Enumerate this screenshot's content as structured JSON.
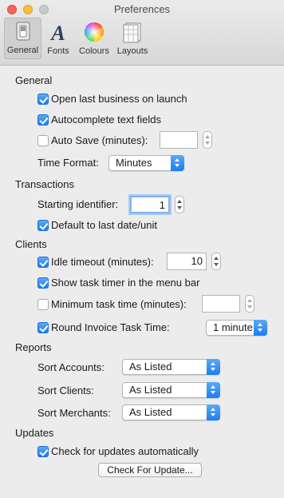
{
  "window": {
    "title": "Preferences"
  },
  "toolbar": {
    "items": [
      {
        "label": "General",
        "icon": "switch-icon",
        "selected": true
      },
      {
        "label": "Fonts",
        "icon": "font-icon",
        "selected": false
      },
      {
        "label": "Colours",
        "icon": "color-wheel-icon",
        "selected": false
      },
      {
        "label": "Layouts",
        "icon": "layout-icon",
        "selected": false
      }
    ]
  },
  "general": {
    "heading": "General",
    "open_last": {
      "label": "Open last business on launch",
      "checked": true
    },
    "autocomplete": {
      "label": "Autocomplete text fields",
      "checked": true
    },
    "auto_save": {
      "label": "Auto Save (minutes):",
      "checked": false,
      "value": ""
    },
    "time_format": {
      "label": "Time Format:",
      "value": "Minutes"
    }
  },
  "transactions": {
    "heading": "Transactions",
    "starting_identifier": {
      "label": "Starting identifier:",
      "value": "1"
    },
    "default_last": {
      "label": "Default to last date/unit",
      "checked": true
    }
  },
  "clients": {
    "heading": "Clients",
    "idle_timeout": {
      "label": "Idle timeout (minutes):",
      "checked": true,
      "value": "10"
    },
    "show_timer": {
      "label": "Show task timer in the menu bar",
      "checked": true
    },
    "min_task_time": {
      "label": "Minimum task time (minutes):",
      "checked": false,
      "value": ""
    },
    "round_invoice": {
      "label": "Round Invoice Task Time:",
      "checked": true,
      "value": "1 minute"
    }
  },
  "reports": {
    "heading": "Reports",
    "sort_accounts": {
      "label": "Sort Accounts:",
      "value": "As Listed"
    },
    "sort_clients": {
      "label": "Sort Clients:",
      "value": "As Listed"
    },
    "sort_merchants": {
      "label": "Sort Merchants:",
      "value": "As Listed"
    }
  },
  "updates": {
    "heading": "Updates",
    "check_auto": {
      "label": "Check for updates automatically",
      "checked": true
    },
    "check_button": "Check For Update..."
  },
  "colors": {
    "accent": "#1b7ef3",
    "background": "#ececec"
  }
}
